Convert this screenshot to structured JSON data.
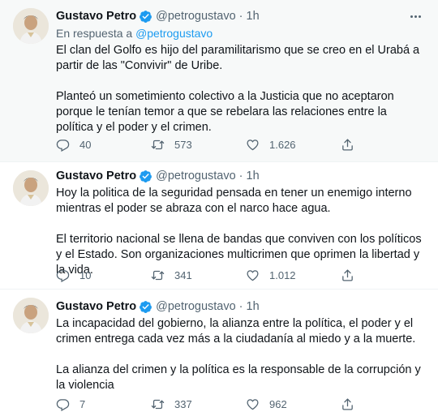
{
  "tweets": [
    {
      "name": "Gustavo Petro",
      "handle": "@petrogustavo",
      "separator": "·",
      "time": "1h",
      "reply_prefix": "En respuesta a",
      "reply_mention": "@petrogustavo",
      "paragraphs": [
        "El clan del Golfo es hijo del paramilitarismo que se creo en el Urabá a partir de las \"Convivir\" de Uribe.",
        "Planteó un sometimiento colectivo a la Justicia que no aceptaron porque le tenían temor a que se rebelara las relaciones entre la política y el poder y el crimen."
      ],
      "replies": "40",
      "retweets": "573",
      "likes": "1.626"
    },
    {
      "name": "Gustavo Petro",
      "handle": "@petrogustavo",
      "separator": "·",
      "time": "1h",
      "paragraphs": [
        "Hoy la politica de la seguridad pensada en tener un enemigo interno mientras el poder se abraza con el narco hace agua.",
        "El territorio nacional se llena de bandas que conviven con los políticos y el Estado. Son organizaciones multicrimen que oprimen la libertad y la vida."
      ],
      "replies": "10",
      "retweets": "341",
      "likes": "1.012"
    },
    {
      "name": "Gustavo Petro",
      "handle": "@petrogustavo",
      "separator": "·",
      "time": "1h",
      "paragraphs": [
        "La incapacidad del gobierno, la alianza entre la política, el poder y el crimen entrega cada vez más a la ciudadanía al miedo y a la muerte.",
        "La alianza del crimen y la política es la responsable de la corrupción y la violencia"
      ],
      "replies": "7",
      "retweets": "337",
      "likes": "962"
    }
  ],
  "icons": {
    "verified": "verified-badge-icon",
    "more": "more-options-icon",
    "reply": "reply-icon",
    "retweet": "retweet-icon",
    "like": "like-icon",
    "share": "share-icon"
  },
  "colors": {
    "accent": "#1d9bf0",
    "secondary_text": "#536471",
    "primary_text": "#0f1419",
    "highlight_bg": "#f7f9f9"
  }
}
